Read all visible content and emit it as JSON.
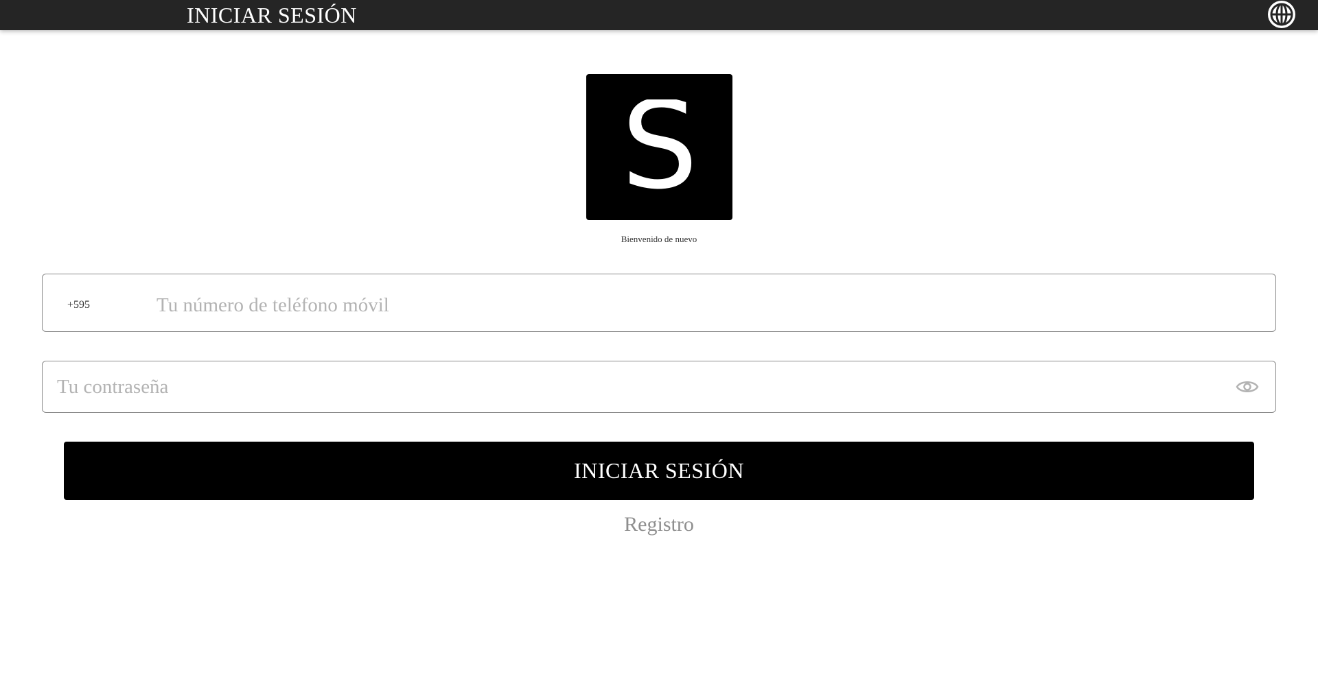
{
  "header": {
    "title": "INICIAR SESIÓN",
    "language_icon": "globe-icon"
  },
  "brand": {
    "logo_letter": "S",
    "logo_bg": "#000000",
    "logo_fg": "#ffffff"
  },
  "welcome": {
    "text": "Bienvenido de nuevo"
  },
  "phone": {
    "country_code": "+595",
    "value": "",
    "placeholder": "Tu número de teléfono móvil"
  },
  "password": {
    "value": "",
    "placeholder": "Tu contraseña",
    "toggle_icon": "eye-icon"
  },
  "actions": {
    "login_label": "INICIAR SESIÓN",
    "register_label": "Registro"
  },
  "colors": {
    "topbar": "#252525",
    "primary_button": "#000000",
    "link": "#8e8e8e"
  }
}
